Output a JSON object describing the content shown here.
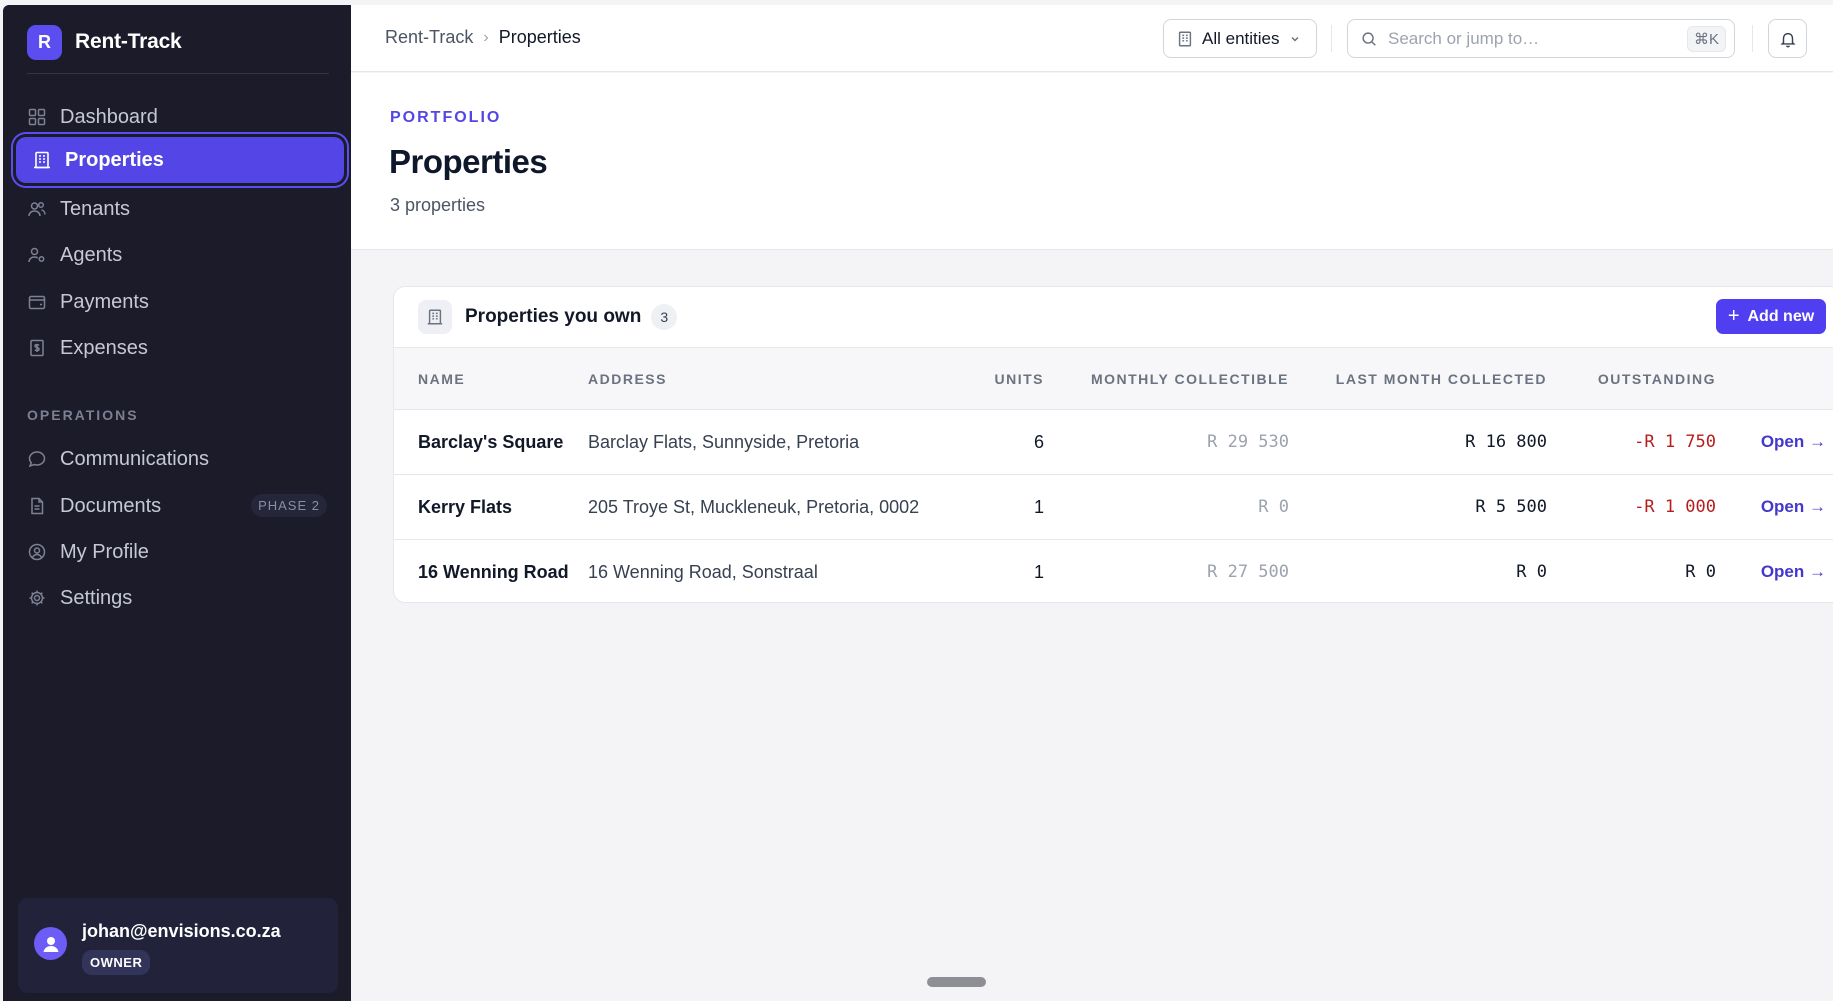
{
  "app": {
    "logo_letter": "R",
    "name": "Rent-Track"
  },
  "sidebar": {
    "items": [
      {
        "label": "Dashboard",
        "icon": "dashboard-icon"
      },
      {
        "label": "Properties",
        "icon": "building-icon",
        "active": true
      },
      {
        "label": "Tenants",
        "icon": "users-icon"
      },
      {
        "label": "Agents",
        "icon": "user-key-icon"
      },
      {
        "label": "Payments",
        "icon": "wallet-icon"
      },
      {
        "label": "Expenses",
        "icon": "receipt-icon"
      }
    ],
    "section_label": "OPERATIONS",
    "ops_items": [
      {
        "label": "Communications",
        "icon": "chat-icon"
      },
      {
        "label": "Documents",
        "icon": "document-icon",
        "badge": "PHASE 2"
      },
      {
        "label": "My Profile",
        "icon": "profile-icon"
      },
      {
        "label": "Settings",
        "icon": "gear-icon"
      }
    ],
    "user": {
      "email": "johan@envisions.co.za",
      "role": "OWNER"
    }
  },
  "topbar": {
    "breadcrumb": [
      "Rent-Track",
      "Properties"
    ],
    "entity_select": "All entities",
    "search_placeholder": "Search or jump to…",
    "search_shortcut": "⌘K"
  },
  "page": {
    "eyebrow": "PORTFOLIO",
    "title": "Properties",
    "subtitle": "3 properties"
  },
  "card": {
    "title": "Properties you own",
    "count": "3",
    "add_label": "Add new"
  },
  "table": {
    "columns": [
      "NAME",
      "ADDRESS",
      "UNITS",
      "MONTHLY COLLECTIBLE",
      "LAST MONTH COLLECTED",
      "OUTSTANDING"
    ],
    "rows": [
      {
        "name": "Barclay's Square",
        "address": "Barclay Flats, Sunnyside, Pretoria",
        "units": "6",
        "monthly": "R 29 530",
        "last_month": "R 16 800",
        "outstanding": "-R 1 750",
        "action": "Open →"
      },
      {
        "name": "Kerry Flats",
        "address": "205 Troye St, Muckleneuk, Pretoria, 0002",
        "units": "1",
        "monthly": "R 0",
        "last_month": "R 5 500",
        "outstanding": "-R 1 000",
        "action": "Open →"
      },
      {
        "name": "16 Wenning Road",
        "address": "16 Wenning Road, Sonstraal",
        "units": "1",
        "monthly": "R 27 500",
        "last_month": "R 0",
        "outstanding": "R 0",
        "action": "Open →"
      }
    ]
  },
  "colors": {
    "accent": "#5446e6",
    "sidebar_bg": "#1b1b29",
    "negative": "#b91c1c",
    "link": "#4338ca"
  }
}
